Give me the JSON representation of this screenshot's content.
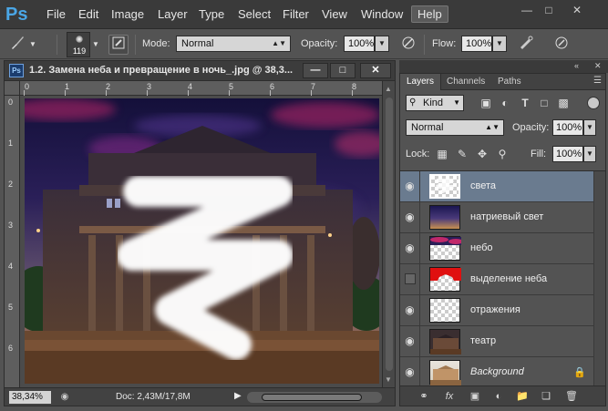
{
  "app": {
    "logo": "Ps",
    "menu": [
      "File",
      "Edit",
      "Image",
      "Layer",
      "Type",
      "Select",
      "Filter",
      "View",
      "Window",
      "Help"
    ],
    "active_menu": "Help",
    "window_controls": [
      "minimize",
      "restore",
      "close"
    ]
  },
  "options": {
    "brush_size": "119",
    "mode_label": "Mode:",
    "mode_value": "Normal",
    "opacity_label": "Opacity:",
    "opacity_value": "100%",
    "flow_label": "Flow:",
    "flow_value": "100%"
  },
  "document": {
    "title": "1.2. Замена неба и превращение в ночь_.jpg @ 38,3...",
    "ruler_h": [
      "0",
      "1",
      "2",
      "3",
      "4",
      "5",
      "6",
      "7",
      "8"
    ],
    "ruler_v": [
      "0",
      "1",
      "2",
      "3",
      "4",
      "5",
      "6"
    ],
    "zoom": "38,34%",
    "doc_size": "Doc: 2,43M/17,8M"
  },
  "layers_panel": {
    "tabs": [
      "Layers",
      "Channels",
      "Paths"
    ],
    "active_tab": "Layers",
    "kind_label": "Kind",
    "blend_mode": "Normal",
    "opacity_label": "Opacity:",
    "opacity_value": "100%",
    "lock_label": "Lock:",
    "fill_label": "Fill:",
    "fill_value": "100%",
    "layers": [
      {
        "name": "света",
        "visible": true,
        "selected": true,
        "thumb": "light"
      },
      {
        "name": "натриевый свет",
        "visible": true,
        "selected": false,
        "thumb": "gradient"
      },
      {
        "name": "небо",
        "visible": true,
        "selected": false,
        "thumb": "sky"
      },
      {
        "name": "выделение неба",
        "visible": false,
        "selected": false,
        "thumb": "redmask"
      },
      {
        "name": "отражения",
        "visible": true,
        "selected": false,
        "thumb": "checker"
      },
      {
        "name": "театр",
        "visible": true,
        "selected": false,
        "thumb": "theater"
      },
      {
        "name": "Background",
        "visible": true,
        "selected": false,
        "thumb": "background",
        "locked": true
      }
    ]
  },
  "colors": {
    "menubar": "#3a3a3a",
    "panel": "#535353",
    "selection": "#6a7b8f",
    "ps_blue": "#4aa6e6"
  }
}
